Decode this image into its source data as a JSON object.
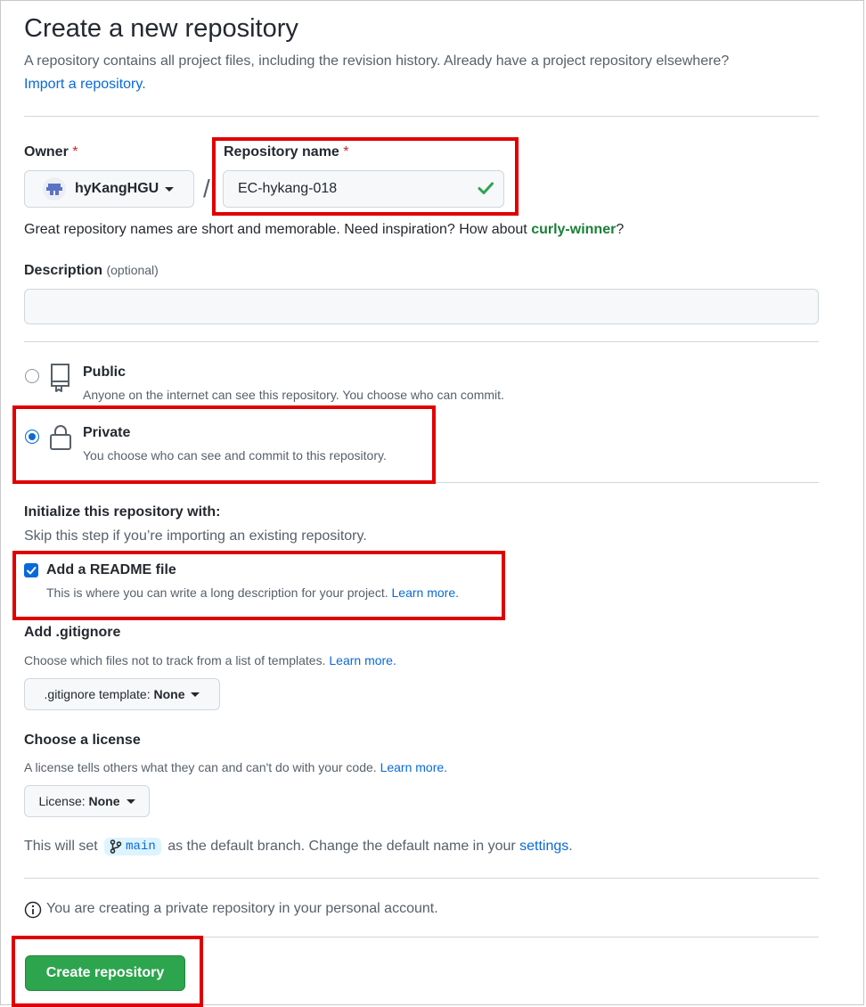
{
  "header": {
    "title": "Create a new repository",
    "subtitle": "A repository contains all project files, including the revision history. Already have a project repository elsewhere?",
    "import_link": "Import a repository."
  },
  "owner": {
    "label": "Owner",
    "required_mark": "*",
    "value": "hyKangHGU",
    "separator": "/"
  },
  "repo_name": {
    "label": "Repository name",
    "required_mark": "*",
    "value": "EC-hykang-018"
  },
  "name_hint": {
    "prefix": "Great repository names are short and memorable. Need inspiration? How about ",
    "suggestion": "curly-winner",
    "suffix": "?"
  },
  "description": {
    "label": "Description",
    "optional": "(optional)",
    "value": ""
  },
  "visibility": {
    "public": {
      "title": "Public",
      "desc": "Anyone on the internet can see this repository. You choose who can commit.",
      "selected": false
    },
    "private": {
      "title": "Private",
      "desc": "You choose who can see and commit to this repository.",
      "selected": true
    }
  },
  "init": {
    "heading": "Initialize this repository with:",
    "subheading": "Skip this step if you’re importing an existing repository.",
    "readme": {
      "label": "Add a README file",
      "desc": "This is where you can write a long description for your project.",
      "link": "Learn more.",
      "checked": true
    }
  },
  "gitignore": {
    "heading": "Add .gitignore",
    "desc": "Choose which files not to track from a list of templates.",
    "link": "Learn more.",
    "button_prefix": ".gitignore template:",
    "button_value": "None"
  },
  "license": {
    "heading": "Choose a license",
    "desc": "A license tells others what they can and can't do with your code.",
    "link": "Learn more.",
    "button_prefix": "License:",
    "button_value": "None"
  },
  "branch": {
    "prefix": "This will set",
    "name": "main",
    "middle": "as the default branch. Change the default name in your",
    "link": "settings",
    "suffix": "."
  },
  "notice": {
    "text": "You are creating a private repository in your personal account."
  },
  "submit": {
    "label": "Create repository"
  },
  "colors": {
    "accent_link": "#0969da",
    "create_button": "#2da44e",
    "success_check": "#2da44e",
    "required_asterisk": "#cf222e",
    "highlight_box": "#e00000"
  }
}
